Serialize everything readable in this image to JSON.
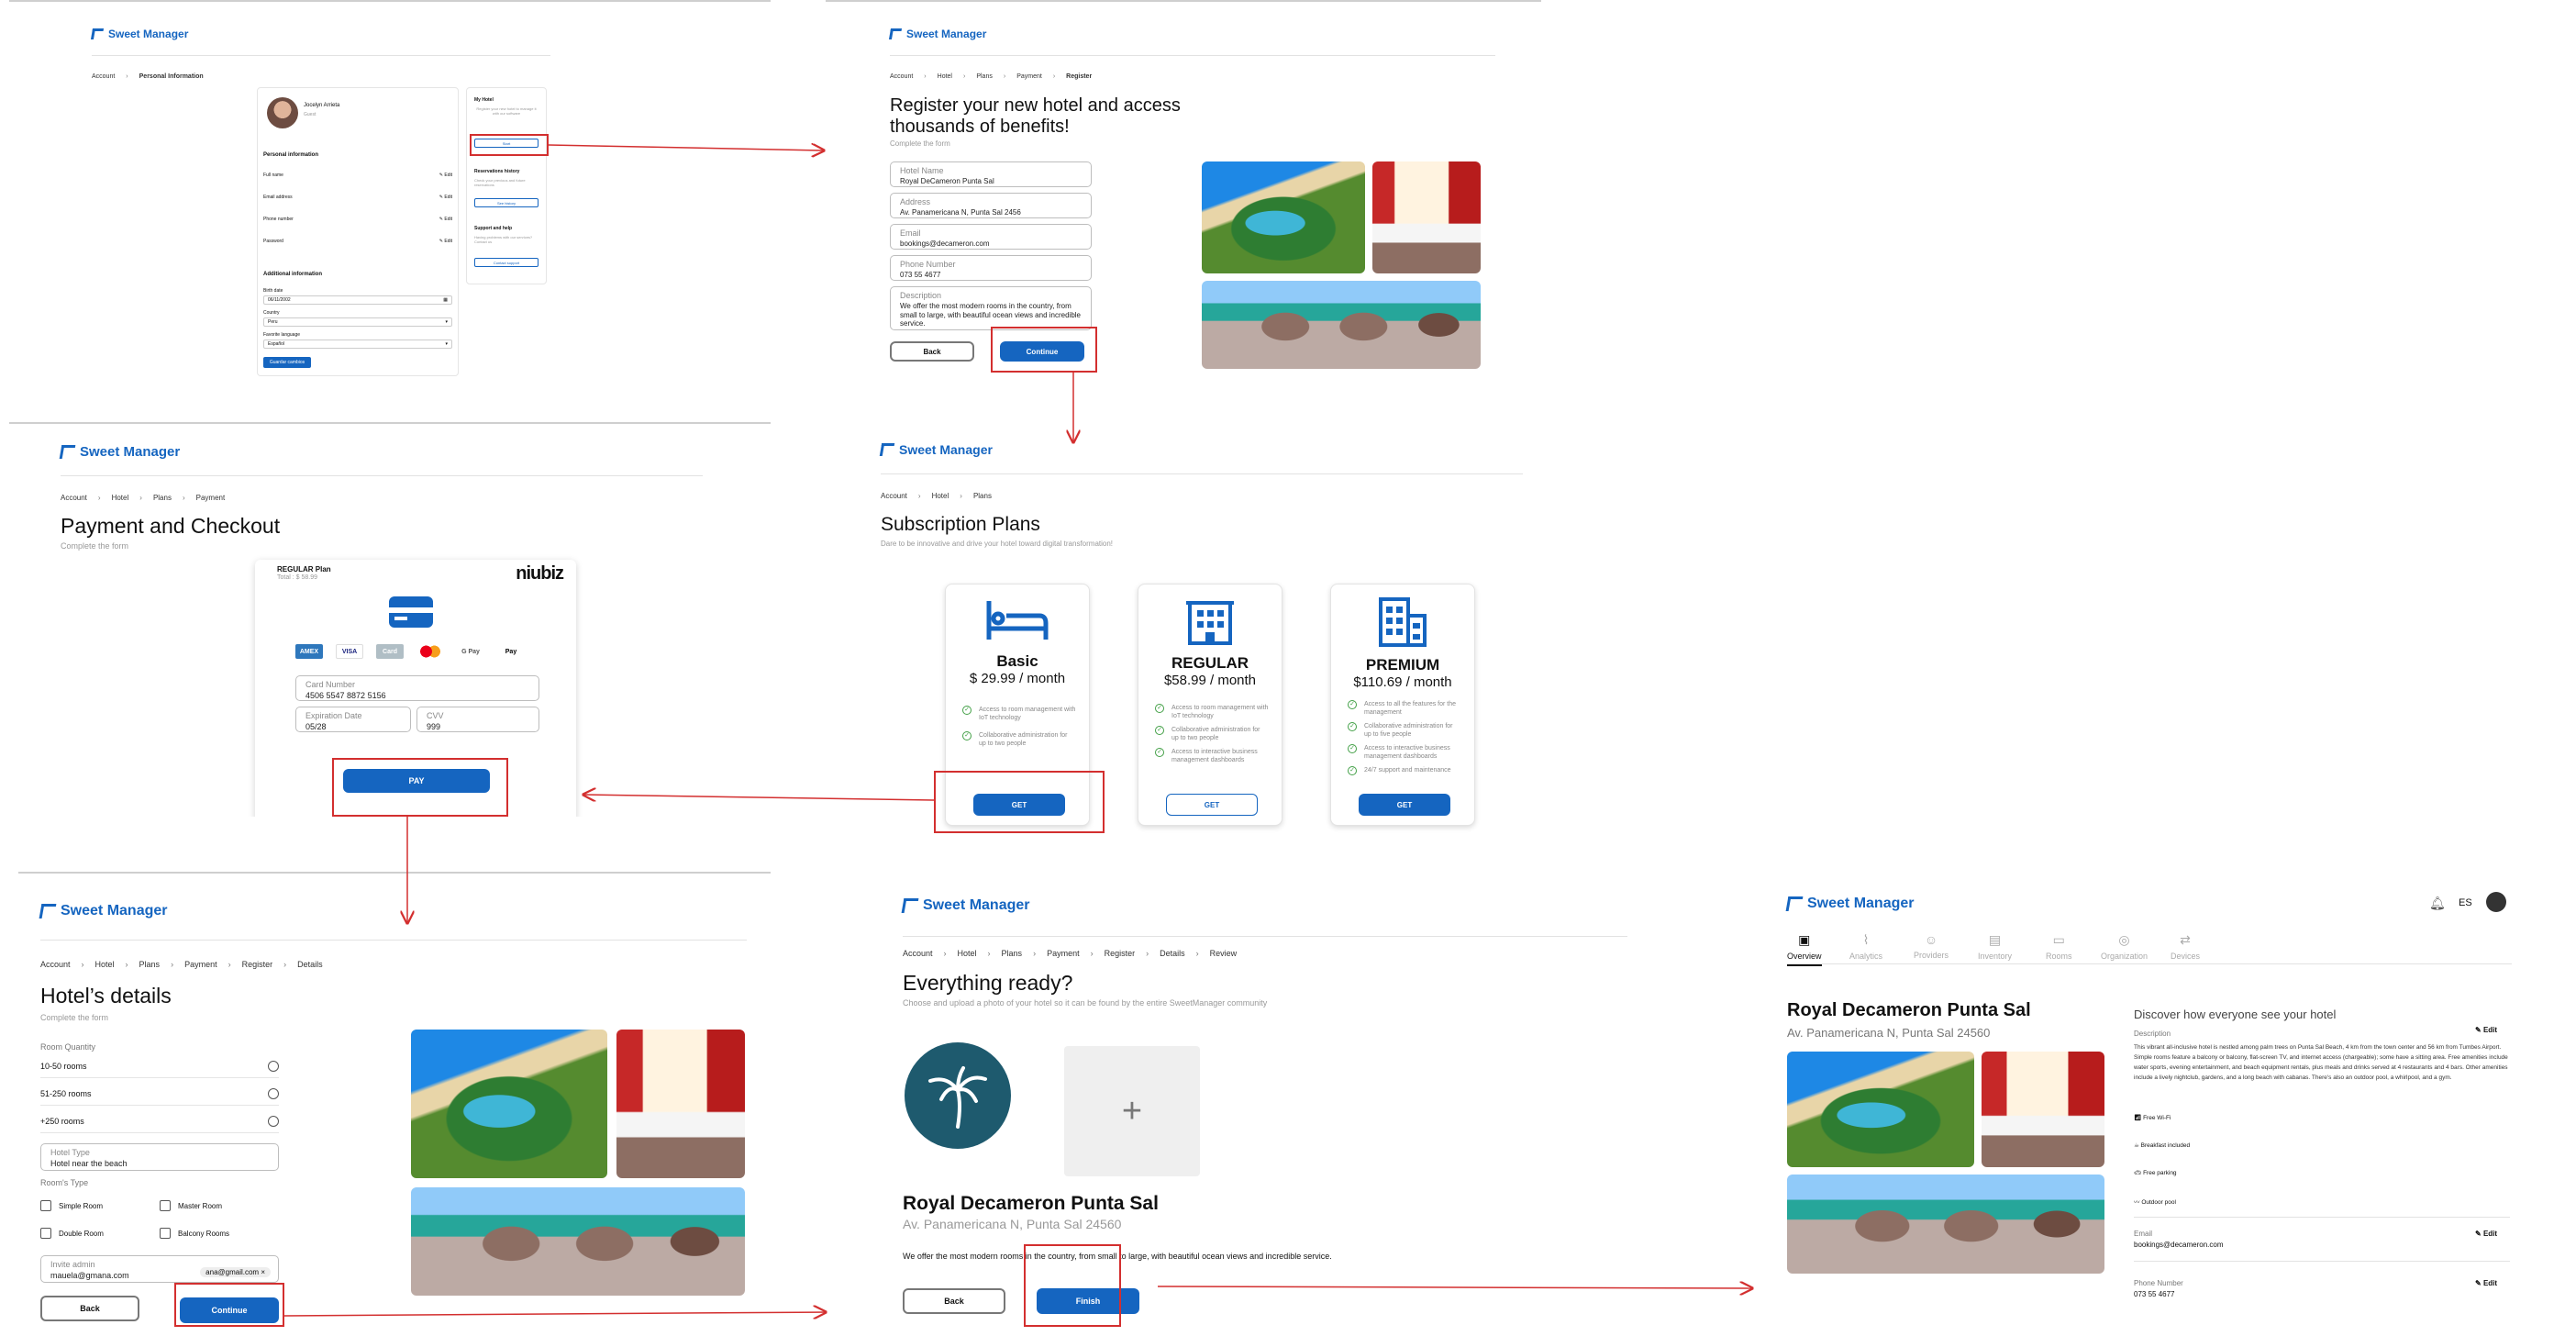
{
  "brand": {
    "name": "Sweet Manager",
    "accent": "#1565c0",
    "annotation": "#d32f2f"
  },
  "s1": {
    "crumb": [
      "Account",
      "Personal Information"
    ],
    "user": {
      "name": "Jocelyn Arrieta",
      "role": "Guest"
    },
    "personal_title": "Personal information",
    "fields": [
      "Full name",
      "Email address",
      "Phone number",
      "Password"
    ],
    "edit": "Edit",
    "additional_title": "Additional information",
    "birth_label": "Birth date",
    "birth_val": "06/11/2002",
    "country_label": "Country",
    "country_val": "Peru",
    "lang_label": "Favorite language",
    "lang_val": "Español",
    "save": "Guardar cambios",
    "hotel_card": {
      "title": "My Hotel",
      "text": "Register your new hotel to manage it with our software",
      "btn": "Start"
    },
    "res_card": {
      "title": "Reservations history",
      "text": "Check your previous and future reservations",
      "btn": "See history"
    },
    "support_card": {
      "title": "Support and help",
      "text": "Having problems with our services? Contact us",
      "btn": "Contact support"
    }
  },
  "s2": {
    "crumb": [
      "Account",
      "Hotel",
      "Plans",
      "Payment",
      "Register"
    ],
    "title": "Register your new hotel and access thousands of benefits!",
    "subtitle": "Complete the form",
    "f_name_l": "Hotel Name",
    "f_name_v": "Royal DeCameron Punta Sal",
    "f_addr_l": "Address",
    "f_addr_v": "Av. Panamericana N, Punta Sal 2456",
    "f_email_l": "Email",
    "f_email_v": "bookings@decameron.com",
    "f_phone_l": "Phone Number",
    "f_phone_v": "073 55 4677",
    "f_desc_l": "Description",
    "f_desc_v": "We offer the most modern rooms in the country, from small to large, with beautiful ocean views and incredible service.",
    "back": "Back",
    "continue": "Continue"
  },
  "s3": {
    "crumb": [
      "Account",
      "Hotel",
      "Plans",
      "Payment"
    ],
    "title": "Payment and Checkout",
    "subtitle": "Complete the form",
    "plan_name": "REGULAR Plan",
    "plan_total": "Total : $ 58.99",
    "provider": "niubiz",
    "card_label": "Card Number",
    "card_val": "4506 5547 8872 5156",
    "exp_label": "Expiration Date",
    "exp_val": "05/28",
    "cvv_label": "CVV",
    "cvv_val": "999",
    "pay": "PAY",
    "methods": [
      "AMEX",
      "VISA",
      "Card",
      "MC",
      "G Pay",
      "Pay"
    ]
  },
  "s4": {
    "crumb": [
      "Account",
      "Hotel",
      "Plans"
    ],
    "title": "Subscription Plans",
    "subtitle": "Dare to be innovative and drive your hotel toward digital transformation!",
    "plans": [
      {
        "name": "Basic",
        "price": "$ 29.99 / month",
        "features": [
          "Access to room management with IoT technology",
          "Collaborative administration for up to two people"
        ],
        "btn": "GET",
        "icon": "bed-icon"
      },
      {
        "name": "REGULAR",
        "price": "$58.99 / month",
        "features": [
          "Access to room management with IoT technology",
          "Collaborative administration for up to two people",
          "Access to interactive business management dashboards"
        ],
        "btn": "GET",
        "icon": "building-icon"
      },
      {
        "name": "PREMIUM",
        "price": "$110.69 / month",
        "features": [
          "Access to all the features for the management",
          "Collaborative administration for up to five people",
          "Access to interactive business management dashboards",
          "24/7 support and maintenance"
        ],
        "btn": "GET",
        "icon": "office-icon"
      }
    ]
  },
  "s5": {
    "crumb": [
      "Account",
      "Hotel",
      "Plans",
      "Payment",
      "Register",
      "Details"
    ],
    "title": "Hotel’s details",
    "subtitle": "Complete the form",
    "qty_label": "Room Quantity",
    "qty": [
      "10-50 rooms",
      "51-250 rooms",
      "+250 rooms"
    ],
    "type_label": "Hotel Type",
    "type_val": "Hotel near the beach",
    "rooms_label": "Room's Type",
    "rooms": [
      "Simple Room",
      "Master Room",
      "Double Room",
      "Balcony Rooms"
    ],
    "invite_label": "Invite admin",
    "invite_val": "mauela@gmana.com",
    "invite_chip": "ana@gmail.com",
    "back": "Back",
    "continue": "Continue"
  },
  "s6": {
    "crumb": [
      "Account",
      "Hotel",
      "Plans",
      "Payment",
      "Register",
      "Details",
      "Review"
    ],
    "title": "Everything ready?",
    "subtitle": "Choose and upload a photo of your hotel so it can be found by the entire SweetManager community",
    "hotel": "Royal Decameron Punta Sal",
    "address": "Av. Panamericana N, Punta Sal 24560",
    "desc": "We offer the most modern rooms in the country, from small to large, with beautiful ocean views and incredible service.",
    "back": "Back",
    "finish": "Finish",
    "plus": "+"
  },
  "s7": {
    "lang": "ES",
    "tabs": [
      "Overview",
      "Analytics",
      "Providers",
      "Inventory",
      "Rooms",
      "Organization",
      "Devices"
    ],
    "hotel": "Royal Decameron Punta Sal",
    "address": "Av. Panamericana N, Punta Sal 24560",
    "discover": "Discover how everyone see your hotel",
    "desc_label": "Description",
    "desc": "This vibrant all-inclusive hotel is nestled among palm trees on Punta Sal Beach, 4 km from the town center and 56 km from Tumbes Airport. Simple rooms feature a balcony or balcony, flat-screen TV, and internet access (chargeable); some have a sitting area. Free amenities include water sports, evening entertainment, and beach equipment rentals, plus meals and drinks served at 4 restaurants and 4 bars. Other amenities include a lively nightclub, gardens, and a long beach with cabanas. There's also an outdoor pool, a whirlpool, and a gym.",
    "amenities": [
      "Free Wi-Fi",
      "Breakfast included",
      "Free parking",
      "Outdoor pool"
    ],
    "email_label": "Email",
    "email": "bookings@decameron.com",
    "phone_label": "Phone Number",
    "phone": "073 55 4677",
    "edit": "Edit"
  }
}
